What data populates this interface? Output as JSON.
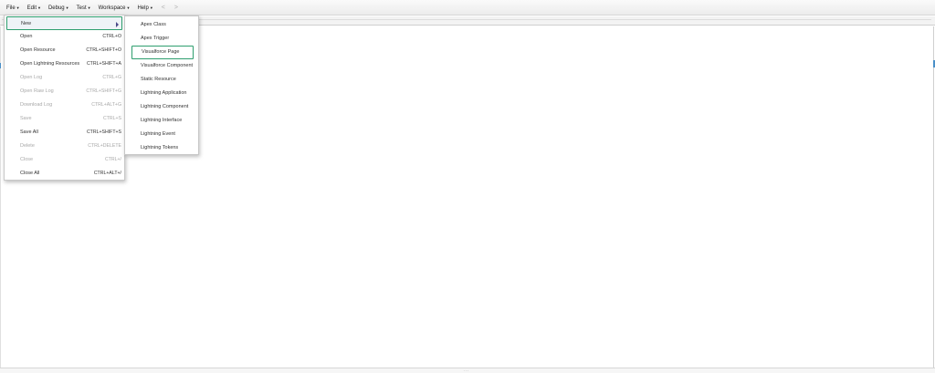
{
  "menubar": {
    "items": [
      {
        "label": "File"
      },
      {
        "label": "Edit"
      },
      {
        "label": "Debug"
      },
      {
        "label": "Test"
      },
      {
        "label": "Workspace"
      },
      {
        "label": "Help"
      }
    ],
    "back_arrow": "<",
    "forward_arrow": ">"
  },
  "file_menu": {
    "items": [
      {
        "label": "New",
        "shortcut": "",
        "disabled": false
      },
      {
        "label": "Open",
        "shortcut": "CTRL+O",
        "disabled": false
      },
      {
        "label": "Open Resource",
        "shortcut": "CTRL+SHIFT+O",
        "disabled": false
      },
      {
        "label": "Open Lightning Resources",
        "shortcut": "CTRL+SHIFT+A",
        "disabled": false
      },
      {
        "label": "Open Log",
        "shortcut": "CTRL+G",
        "disabled": true
      },
      {
        "label": "Open Raw Log",
        "shortcut": "CTRL+SHIFT+G",
        "disabled": true
      },
      {
        "label": "Download Log",
        "shortcut": "CTRL+ALT+G",
        "disabled": true
      },
      {
        "label": "Save",
        "shortcut": "CTRL+S",
        "disabled": true
      },
      {
        "label": "Save All",
        "shortcut": "CTRL+SHIFT+S",
        "disabled": false
      },
      {
        "label": "Delete",
        "shortcut": "CTRL+DELETE",
        "disabled": true
      },
      {
        "label": "Close",
        "shortcut": "CTRL+/",
        "disabled": true
      },
      {
        "label": "Close All",
        "shortcut": "CTRL+ALT+/",
        "disabled": false
      }
    ]
  },
  "new_submenu": {
    "items": [
      {
        "label": "Apex Class"
      },
      {
        "label": "Apex Trigger"
      },
      {
        "label": "Visualforce Page"
      },
      {
        "label": "Visualforce Component"
      },
      {
        "label": "Static Resource"
      },
      {
        "label": "Lightning Application"
      },
      {
        "label": "Lightning Component"
      },
      {
        "label": "Lightning Interface"
      },
      {
        "label": "Lightning Event"
      },
      {
        "label": "Lightning Tokens"
      }
    ]
  },
  "colors": {
    "highlight_border": "#2e9e6e",
    "disabled_text": "#a8a8a8",
    "submenu_arrow": "#4a4a8a"
  }
}
